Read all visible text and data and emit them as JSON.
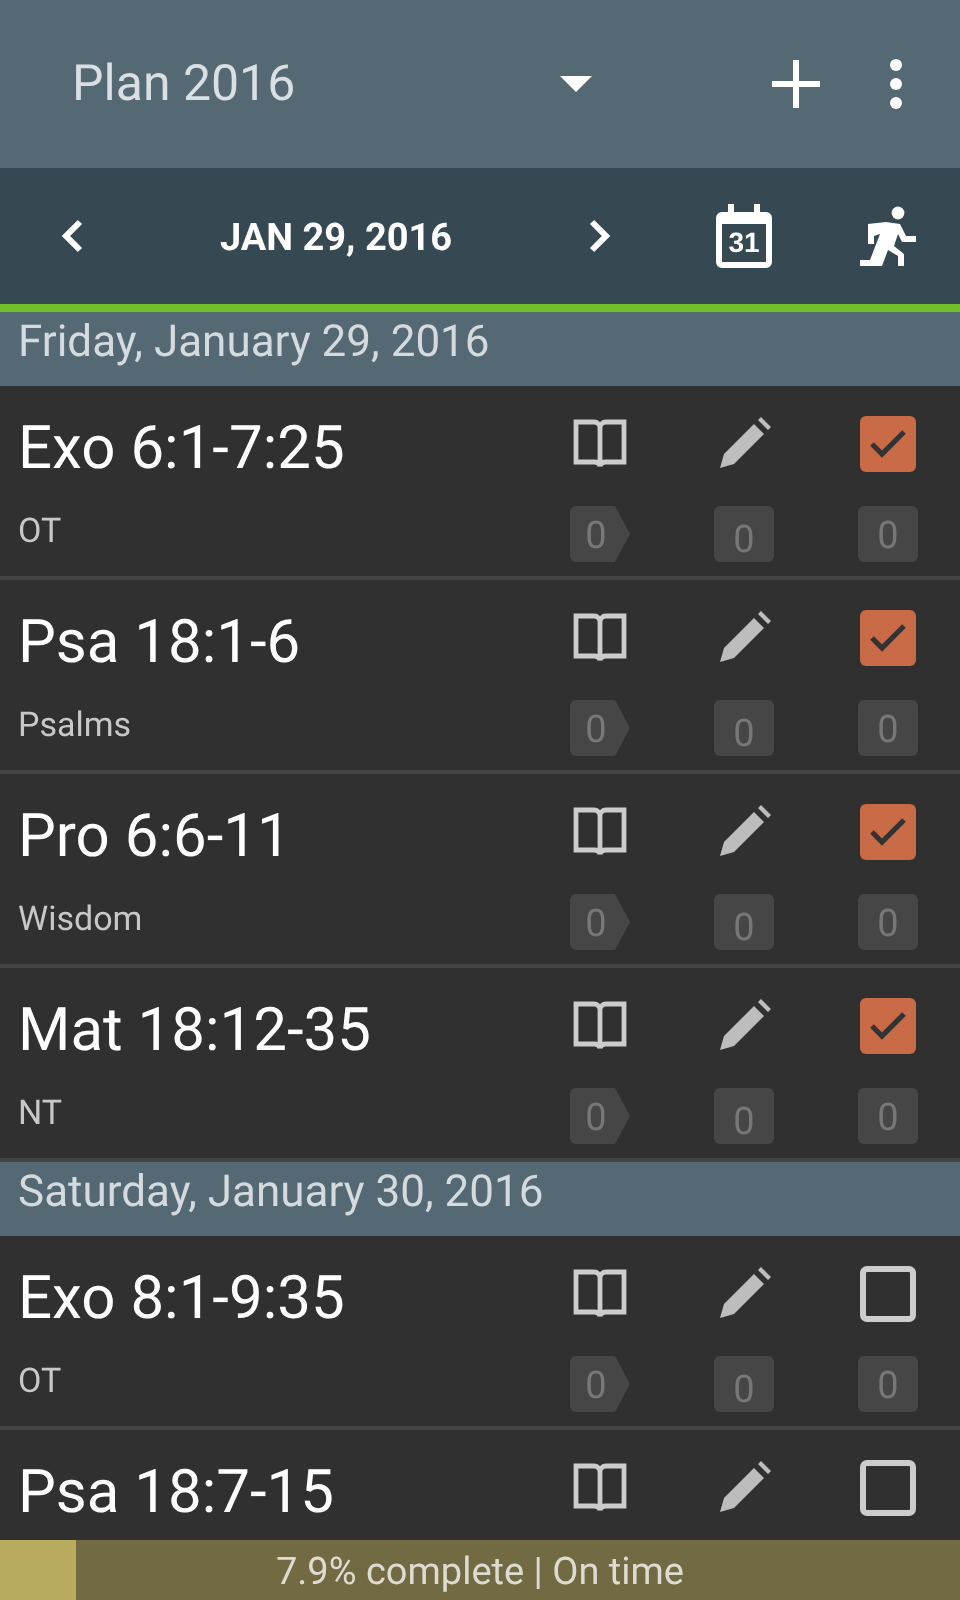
{
  "app_bar": {
    "title": "Plan 2016"
  },
  "date_bar": {
    "date": "JAN 29, 2016",
    "calendar_day": "31"
  },
  "days": [
    {
      "header": "Friday, January 29, 2016",
      "readings": [
        {
          "passage": "Exo 6:1-7:25",
          "category": "OT",
          "checked": true,
          "counts": [
            "0",
            "0",
            "0"
          ]
        },
        {
          "passage": "Psa 18:1-6",
          "category": "Psalms",
          "checked": true,
          "counts": [
            "0",
            "0",
            "0"
          ]
        },
        {
          "passage": "Pro 6:6-11",
          "category": "Wisdom",
          "checked": true,
          "counts": [
            "0",
            "0",
            "0"
          ]
        },
        {
          "passage": "Mat 18:12-35",
          "category": "NT",
          "checked": true,
          "counts": [
            "0",
            "0",
            "0"
          ]
        }
      ]
    },
    {
      "header": "Saturday, January 30, 2016",
      "readings": [
        {
          "passage": "Exo 8:1-9:35",
          "category": "OT",
          "checked": false,
          "counts": [
            "0",
            "0",
            "0"
          ]
        },
        {
          "passage": "Psa 18:7-15",
          "checked": false
        }
      ]
    }
  ],
  "progress": {
    "level": 0.079,
    "text": "7.9% complete | On time"
  }
}
